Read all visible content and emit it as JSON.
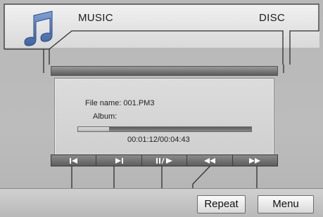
{
  "header": {
    "left_title": "MUSIC",
    "right_title": "DISC",
    "icon": "music-note-icon"
  },
  "track": {
    "file_name_label": "File name: 001.PM3",
    "album_label": "Album:",
    "time": "00:01:12/00:04:43",
    "progress_fraction": 0.18
  },
  "controls": [
    {
      "name": "previous-icon"
    },
    {
      "name": "next-icon"
    },
    {
      "name": "play-pause-icon"
    },
    {
      "name": "rewind-icon"
    },
    {
      "name": "fast-forward-icon"
    }
  ],
  "footer": {
    "repeat_label": "Repeat",
    "menu_label": "Menu"
  },
  "colors": {
    "background": "#bcbcbc",
    "panel": "#d6d6d6",
    "bar": "#6a6a6a"
  }
}
